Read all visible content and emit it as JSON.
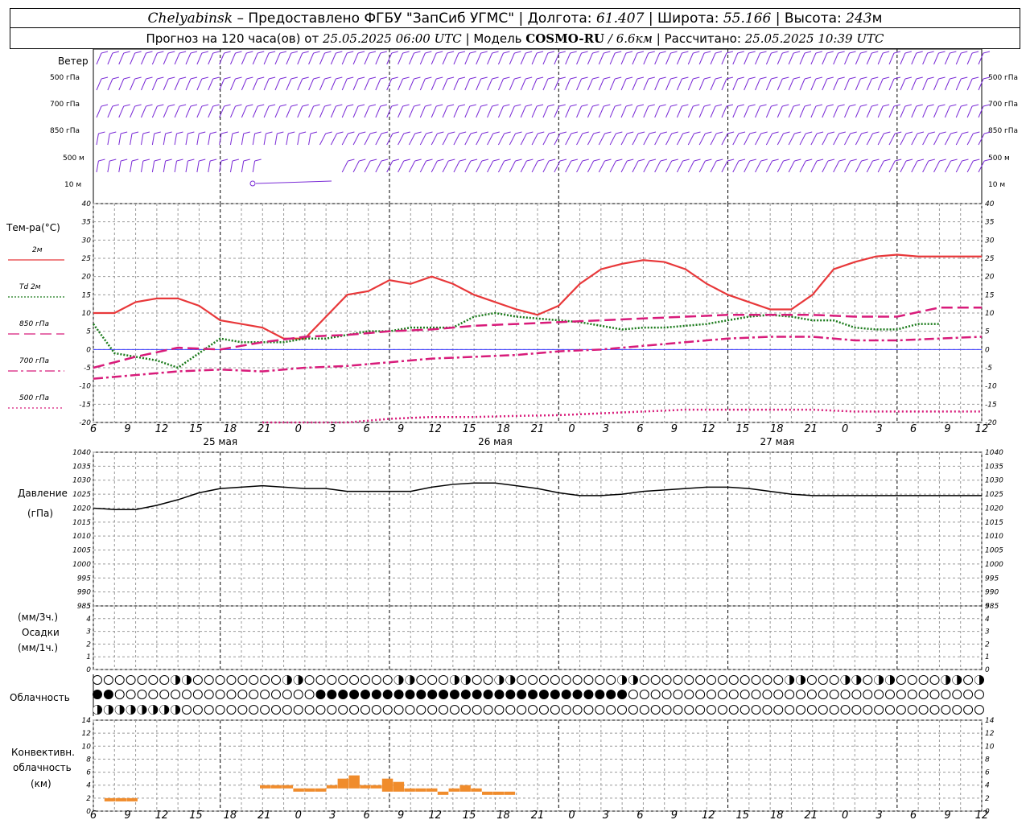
{
  "header": {
    "city": "Chelyabinsk",
    "provider": "– Предоставлено ФГБУ \"ЗапСиб УГМС\" |",
    "lon_label": "Долгота:",
    "lon_value": "61.407",
    "lat_label": "| Широта:",
    "lat_value": "55.166",
    "alt_label": "| Высота:",
    "alt_value": "243",
    "alt_unit": "м",
    "forecast_text": "Прогноз на 120 часа(ов) от",
    "forecast_date": "25.05.2025 06:00 UTC",
    "model_label": "| Модель",
    "model_name": "COSMO-RU",
    "model_res": "/ 6.6км",
    "computed_label": "| Рассчитано:",
    "computed_date": "25.05.2025 10:39 UTC"
  },
  "labels": {
    "wind_title": "Ветер",
    "wind_levels": [
      "500 гПа",
      "700 гПа",
      "850 гПа",
      "500 м",
      "10  м"
    ],
    "temp_title": "Тем-ра(°С)",
    "pressure_title": "Давление",
    "pressure_unit": "(гПа)",
    "precip_units": "(мм/3ч.)",
    "precip_title": "Осадки",
    "precip_units2": "(мм/1ч.)",
    "cloud_title": "Облачность",
    "conv_title1": "Конвективн.",
    "conv_title2": "облачность",
    "conv_unit": "(км)"
  },
  "legend": [
    {
      "label": "2м",
      "color": "#e8383a",
      "style": "solid"
    },
    {
      "label": "Td  2м",
      "color": "#1a7a1a",
      "style": "dotted"
    },
    {
      "label": "850 гПа",
      "color": "#d81b7a",
      "style": "longdash"
    },
    {
      "label": "700 гПа",
      "color": "#d81b7a",
      "style": "dashdot"
    },
    {
      "label": "500 гПа",
      "color": "#d81b7a",
      "style": "dots"
    }
  ],
  "x_axis": {
    "hour_labels": [
      "6",
      "9",
      "12",
      "15",
      "18",
      "21",
      "0",
      "3",
      "6",
      "9",
      "12",
      "15",
      "18",
      "21",
      "0",
      "3",
      "6",
      "9",
      "12",
      "15",
      "18",
      "21",
      "0",
      "3",
      "6",
      "9",
      "12"
    ],
    "day_labels": [
      "25 мая",
      "26 мая",
      "27 мая"
    ]
  },
  "chart_data": [
    {
      "type": "line",
      "title": "Тем-ра(°С)",
      "x_unit": "hours since 25.05.2025 06:00 UTC",
      "ylim": [
        -20,
        40
      ],
      "grid": true,
      "series": [
        {
          "name": "2м",
          "x": [
            0,
            3,
            6,
            9,
            12,
            15,
            18,
            21,
            24,
            27,
            30,
            33,
            36,
            39,
            42,
            45,
            48,
            51,
            54,
            57,
            60,
            63,
            66,
            69,
            72,
            75,
            78,
            81,
            84,
            87,
            90,
            93,
            96,
            99,
            102,
            105,
            108,
            111,
            114,
            117,
            120,
            123,
            126
          ],
          "values": [
            10,
            10,
            13,
            14,
            14,
            12,
            8,
            7,
            6,
            3,
            3,
            9,
            15,
            16,
            19,
            18,
            20,
            18,
            15,
            13,
            11,
            9.5,
            12,
            18,
            22,
            23.5,
            24.5,
            24,
            22,
            18,
            15,
            13,
            11,
            11,
            15,
            22,
            24,
            25.5,
            26,
            25.5,
            25.5,
            25.5,
            25.5
          ]
        },
        {
          "name": "Td  2м",
          "x": [
            0,
            3,
            6,
            9,
            12,
            15,
            18,
            21,
            24,
            27,
            30,
            33,
            36,
            39,
            42,
            45,
            48,
            51,
            54,
            57,
            60,
            63,
            66,
            69,
            72,
            75,
            78,
            81,
            84,
            87,
            90,
            93,
            96,
            99,
            102,
            105,
            108,
            111,
            114,
            117,
            120
          ],
          "values": [
            7,
            -1,
            -2,
            -3,
            -5,
            -1,
            3,
            2,
            2,
            2,
            3,
            3,
            4,
            5,
            5,
            6,
            6,
            6,
            9,
            10,
            9,
            8.5,
            8,
            7.5,
            6.5,
            5.5,
            6,
            6,
            6.5,
            7,
            8,
            9,
            9.5,
            9,
            8,
            8,
            6,
            5.5,
            5.5,
            7,
            7
          ]
        },
        {
          "name": "850 гПа",
          "x": [
            0,
            6,
            12,
            18,
            24,
            30,
            36,
            42,
            48,
            54,
            60,
            66,
            72,
            78,
            84,
            90,
            96,
            102,
            108,
            114,
            120,
            126
          ],
          "values": [
            -5,
            -2,
            0.5,
            0,
            2,
            3.5,
            4,
            5,
            5.5,
            6.5,
            7,
            7.5,
            8,
            8.5,
            9,
            9.5,
            9.5,
            9.5,
            9,
            9,
            11.5,
            11.5
          ]
        },
        {
          "name": "700 гПа",
          "x": [
            0,
            6,
            12,
            18,
            24,
            30,
            36,
            42,
            48,
            54,
            60,
            66,
            72,
            78,
            84,
            90,
            96,
            102,
            108,
            114,
            120,
            126
          ],
          "values": [
            -8,
            -7,
            -6,
            -5.5,
            -6,
            -5,
            -4.5,
            -3.5,
            -2.5,
            -2,
            -1.5,
            -0.5,
            0,
            1,
            2,
            3,
            3.5,
            3.5,
            2.5,
            2.5,
            3,
            3.5
          ]
        },
        {
          "name": "500 гПа",
          "x": [
            24,
            36,
            42,
            48,
            54,
            60,
            66,
            72,
            78,
            84,
            90,
            96,
            102,
            108,
            114,
            120,
            126
          ],
          "values": [
            -20,
            -20,
            -19,
            -18.5,
            -18.5,
            -18.2,
            -18,
            -17.5,
            -17,
            -16.5,
            -16.5,
            -16.5,
            -16.5,
            -17,
            -17,
            -17,
            -17
          ]
        }
      ]
    },
    {
      "type": "line",
      "title": "Давление",
      "ylabel": "(гПа)",
      "ylim": [
        985,
        1040
      ],
      "grid": true,
      "series": [
        {
          "name": "",
          "x": [
            0,
            3,
            6,
            9,
            12,
            15,
            18,
            21,
            24,
            27,
            30,
            33,
            36,
            39,
            42,
            45,
            48,
            51,
            54,
            57,
            60,
            63,
            66,
            69,
            72,
            75,
            78,
            81,
            84,
            87,
            90,
            93,
            96,
            99,
            102,
            105,
            108,
            111,
            114,
            117,
            120,
            123,
            126
          ],
          "values": [
            1020,
            1019.5,
            1019.5,
            1021,
            1023,
            1025.5,
            1027,
            1027.5,
            1028,
            1027.5,
            1027,
            1027,
            1026,
            1026,
            1026,
            1026,
            1027.5,
            1028.5,
            1029,
            1029,
            1028,
            1027,
            1025.5,
            1024.5,
            1024.5,
            1025,
            1026,
            1026.5,
            1027,
            1027.5,
            1027.5,
            1027,
            1026,
            1025,
            1024.5,
            1024.5,
            1024.5,
            1024.5,
            1024.5,
            1024.5,
            1024.5,
            1024.5,
            1024.5
          ]
        }
      ]
    },
    {
      "type": "bar",
      "title": "Осадки",
      "ylim": [
        0,
        5
      ],
      "series": [
        {
          "name": "",
          "x": [],
          "values": []
        }
      ]
    },
    {
      "type": "bar",
      "title": "Конвективн. облачность",
      "ylabel": "(км)",
      "ylim": [
        0,
        13
      ],
      "series": [
        {
          "name": "",
          "x": [
            1,
            2,
            3,
            15,
            16,
            17,
            18,
            19,
            20,
            21,
            22,
            23,
            24,
            25,
            26,
            27,
            28,
            29,
            30,
            31,
            32,
            33,
            34,
            35,
            36,
            37
          ],
          "base": [
            1.5,
            1.5,
            1.5,
            3.5,
            3.5,
            3.5,
            3,
            3,
            3,
            3.5,
            3.5,
            3.5,
            3.5,
            3.5,
            3,
            3,
            3,
            3,
            3,
            2.5,
            3,
            3,
            3,
            2.5,
            2.5,
            2.5
          ],
          "values": [
            2,
            2,
            2,
            4,
            4,
            4,
            3.5,
            3.5,
            3.5,
            4,
            5,
            5.5,
            4,
            4,
            5,
            4.5,
            3.5,
            3.5,
            3.5,
            3,
            3.5,
            4,
            3.5,
            3,
            3,
            3
          ]
        }
      ]
    }
  ],
  "colors": {
    "wind": "#7a2bd6",
    "conv": "#f08c2c",
    "grid": "#999999"
  }
}
